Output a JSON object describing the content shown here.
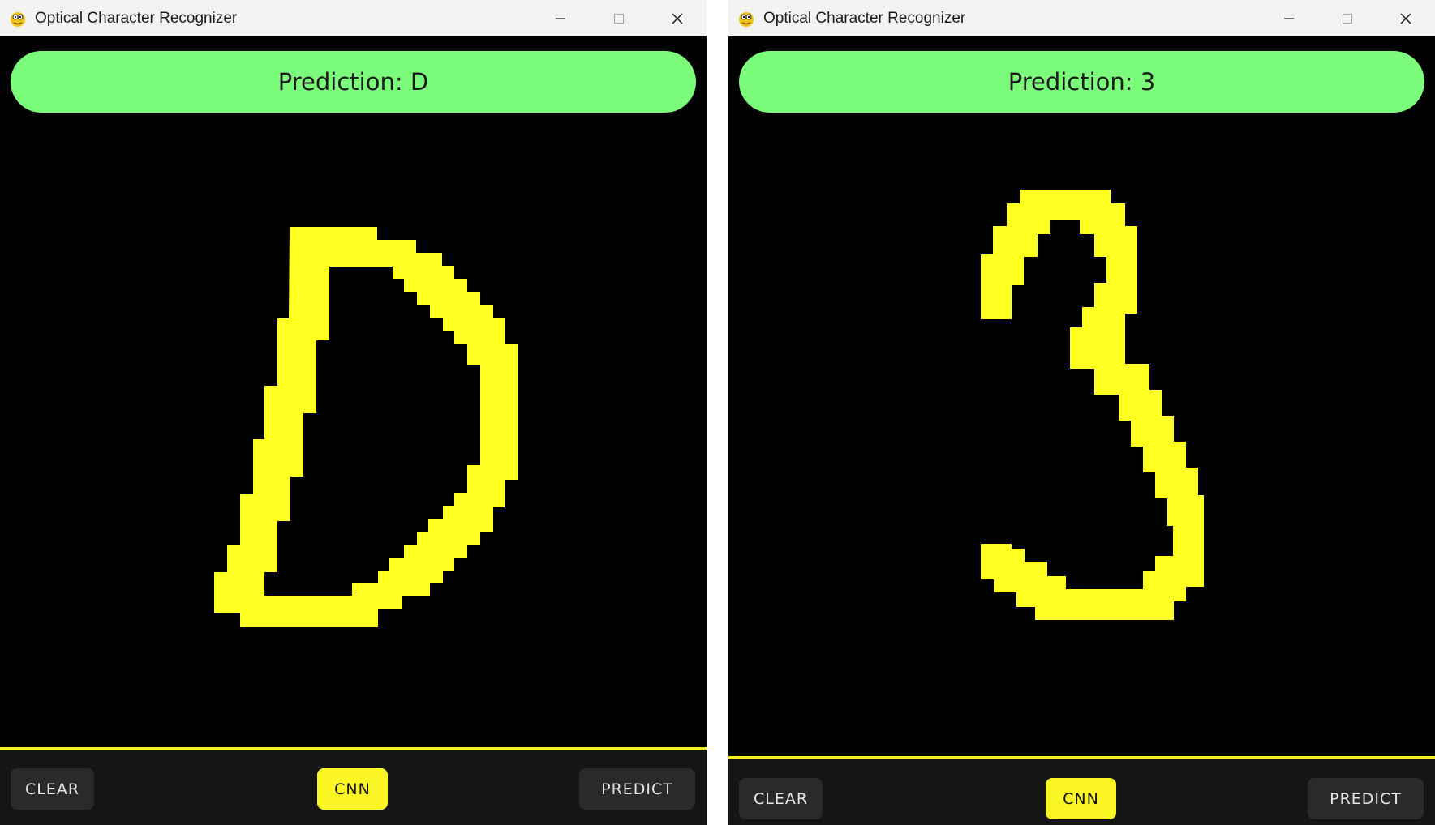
{
  "windows": [
    {
      "title": "Optical Character Recognizer",
      "prediction_label": "Prediction:",
      "prediction_value": "D",
      "canvas_glyph": "handwritten-D",
      "buttons": {
        "clear": "CLEAR",
        "model": "CNN",
        "predict": "PREDICT"
      }
    },
    {
      "title": "Optical Character Recognizer",
      "prediction_label": "Prediction:",
      "prediction_value": "3",
      "canvas_glyph": "handwritten-3",
      "buttons": {
        "clear": "CLEAR",
        "model": "CNN",
        "predict": "PREDICT"
      }
    }
  ],
  "window_controls": [
    "minimize-icon",
    "maximize-icon",
    "close-icon"
  ],
  "colors": {
    "prediction_pill": "#7bfd7b",
    "stroke": "#ffff22",
    "divider": "#f7f01e",
    "model_button": "#fbf624",
    "canvas": "#000000",
    "bottom_bar": "#151515"
  }
}
